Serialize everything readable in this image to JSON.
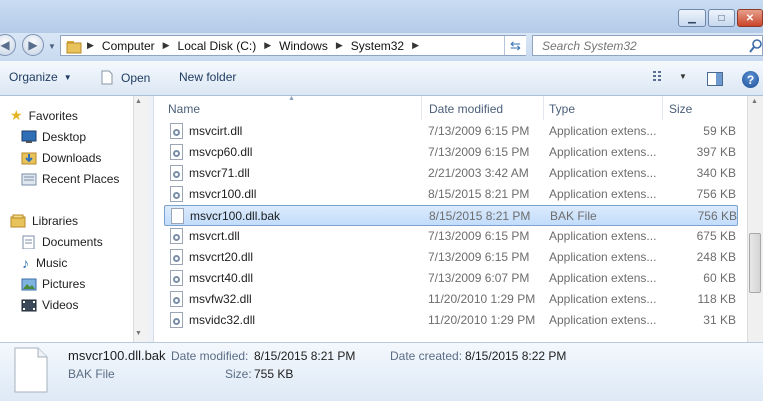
{
  "window": {
    "minimize": "▁",
    "maximize": "□",
    "close": "✕"
  },
  "address": {
    "crumbs": [
      "Computer",
      "Local Disk (C:)",
      "Windows",
      "System32"
    ],
    "separator": "▶",
    "dropdown": "▼",
    "refresh": "⇆"
  },
  "search": {
    "placeholder": "Search System32",
    "icon": "search-icon"
  },
  "toolbar": {
    "organize": "Organize",
    "open": "Open",
    "new_folder": "New folder",
    "help": "?"
  },
  "nav": {
    "favorites": {
      "label": "Favorites",
      "items": [
        "Desktop",
        "Downloads",
        "Recent Places"
      ]
    },
    "libraries": {
      "label": "Libraries",
      "items": [
        "Documents",
        "Music",
        "Pictures",
        "Videos"
      ]
    }
  },
  "columns": {
    "name": "Name",
    "date": "Date modified",
    "type": "Type",
    "size": "Size"
  },
  "files": [
    {
      "name": "msvcirt.dll",
      "date": "7/13/2009 6:15 PM",
      "type": "Application extens...",
      "size": "59 KB"
    },
    {
      "name": "msvcp60.dll",
      "date": "7/13/2009 6:15 PM",
      "type": "Application extens...",
      "size": "397 KB"
    },
    {
      "name": "msvcr71.dll",
      "date": "2/21/2003 3:42 AM",
      "type": "Application extens...",
      "size": "340 KB"
    },
    {
      "name": "msvcr100.dll",
      "date": "8/15/2015 8:21 PM",
      "type": "Application extens...",
      "size": "756 KB"
    },
    {
      "name": "msvcr100.dll.bak",
      "date": "8/15/2015 8:21 PM",
      "type": "BAK File",
      "size": "756 KB",
      "selected": true
    },
    {
      "name": "msvcrt.dll",
      "date": "7/13/2009 6:15 PM",
      "type": "Application extens...",
      "size": "675 KB"
    },
    {
      "name": "msvcrt20.dll",
      "date": "7/13/2009 6:15 PM",
      "type": "Application extens...",
      "size": "248 KB"
    },
    {
      "name": "msvcrt40.dll",
      "date": "7/13/2009 6:07 PM",
      "type": "Application extens...",
      "size": "60 KB"
    },
    {
      "name": "msvfw32.dll",
      "date": "11/20/2010 1:29 PM",
      "type": "Application extens...",
      "size": "118 KB"
    },
    {
      "name": "msvidc32.dll",
      "date": "11/20/2010 1:29 PM",
      "type": "Application extens...",
      "size": "31 KB"
    }
  ],
  "details": {
    "filename": "msvcr100.dll.bak",
    "filetype": "BAK File",
    "modified_label": "Date modified:",
    "modified_value": "8/15/2015 8:21 PM",
    "created_label": "Date created:",
    "created_value": "8/15/2015 8:22 PM",
    "size_label": "Size:",
    "size_value": "755 KB"
  },
  "colors": {
    "selection": "#c1dcfb",
    "selection_border": "#7da2ce",
    "folder": "#e8c35b"
  }
}
